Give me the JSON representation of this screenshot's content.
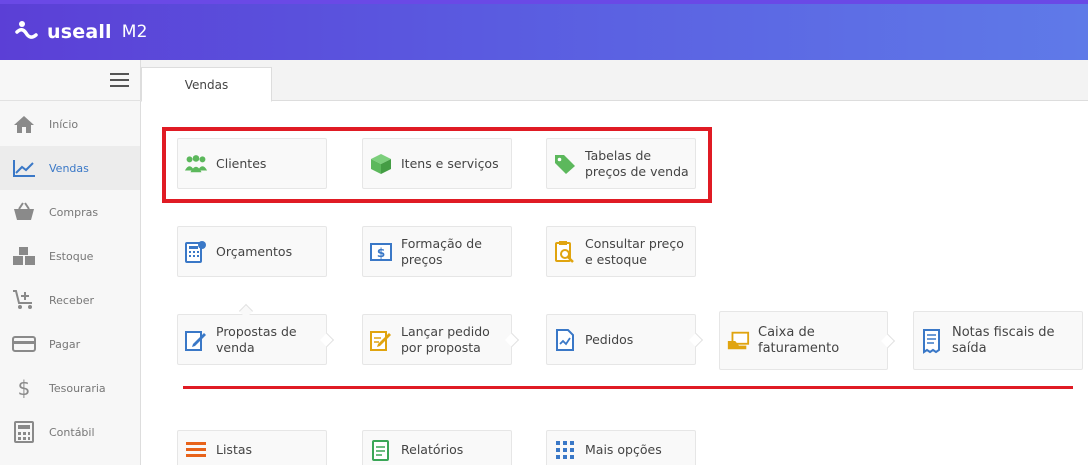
{
  "brand": {
    "name": "useall",
    "product": "M2"
  },
  "sidebar": {
    "items": [
      {
        "label": "Início",
        "icon": "home-icon"
      },
      {
        "label": "Vendas",
        "icon": "chart-line-icon",
        "active": true
      },
      {
        "label": "Compras",
        "icon": "basket-icon"
      },
      {
        "label": "Estoque",
        "icon": "boxes-icon"
      },
      {
        "label": "Receber",
        "icon": "cart-plus-icon"
      },
      {
        "label": "Pagar",
        "icon": "credit-card-icon"
      },
      {
        "label": "Tesouraria",
        "icon": "dollar-icon"
      },
      {
        "label": "Contábil",
        "icon": "calculator-icon"
      }
    ]
  },
  "tabs": [
    {
      "label": "Vendas"
    }
  ],
  "cards": {
    "clientes": "Clientes",
    "itens": "Itens e serviços",
    "tabelas": "Tabelas de preços de venda",
    "orcamentos": "Orçamentos",
    "formacao": "Formação de preços",
    "consultar": "Consultar preço e estoque",
    "propostas": "Propostas de venda",
    "lancar": "Lançar pedido por proposta",
    "pedidos": "Pedidos",
    "caixa": "Caixa de faturamento",
    "notas": "Notas fiscais de saída",
    "listas": "Listas",
    "relatorios": "Relatórios",
    "mais": "Mais opções"
  },
  "colors": {
    "header_start": "#5b3fd6",
    "header_end": "#5f7ae8",
    "highlight": "#e01b24",
    "active_nav": "#3a78c7",
    "green": "#5cb85c",
    "blue": "#3a78c7",
    "gold": "#e0a40f",
    "orange": "#e8631a"
  }
}
